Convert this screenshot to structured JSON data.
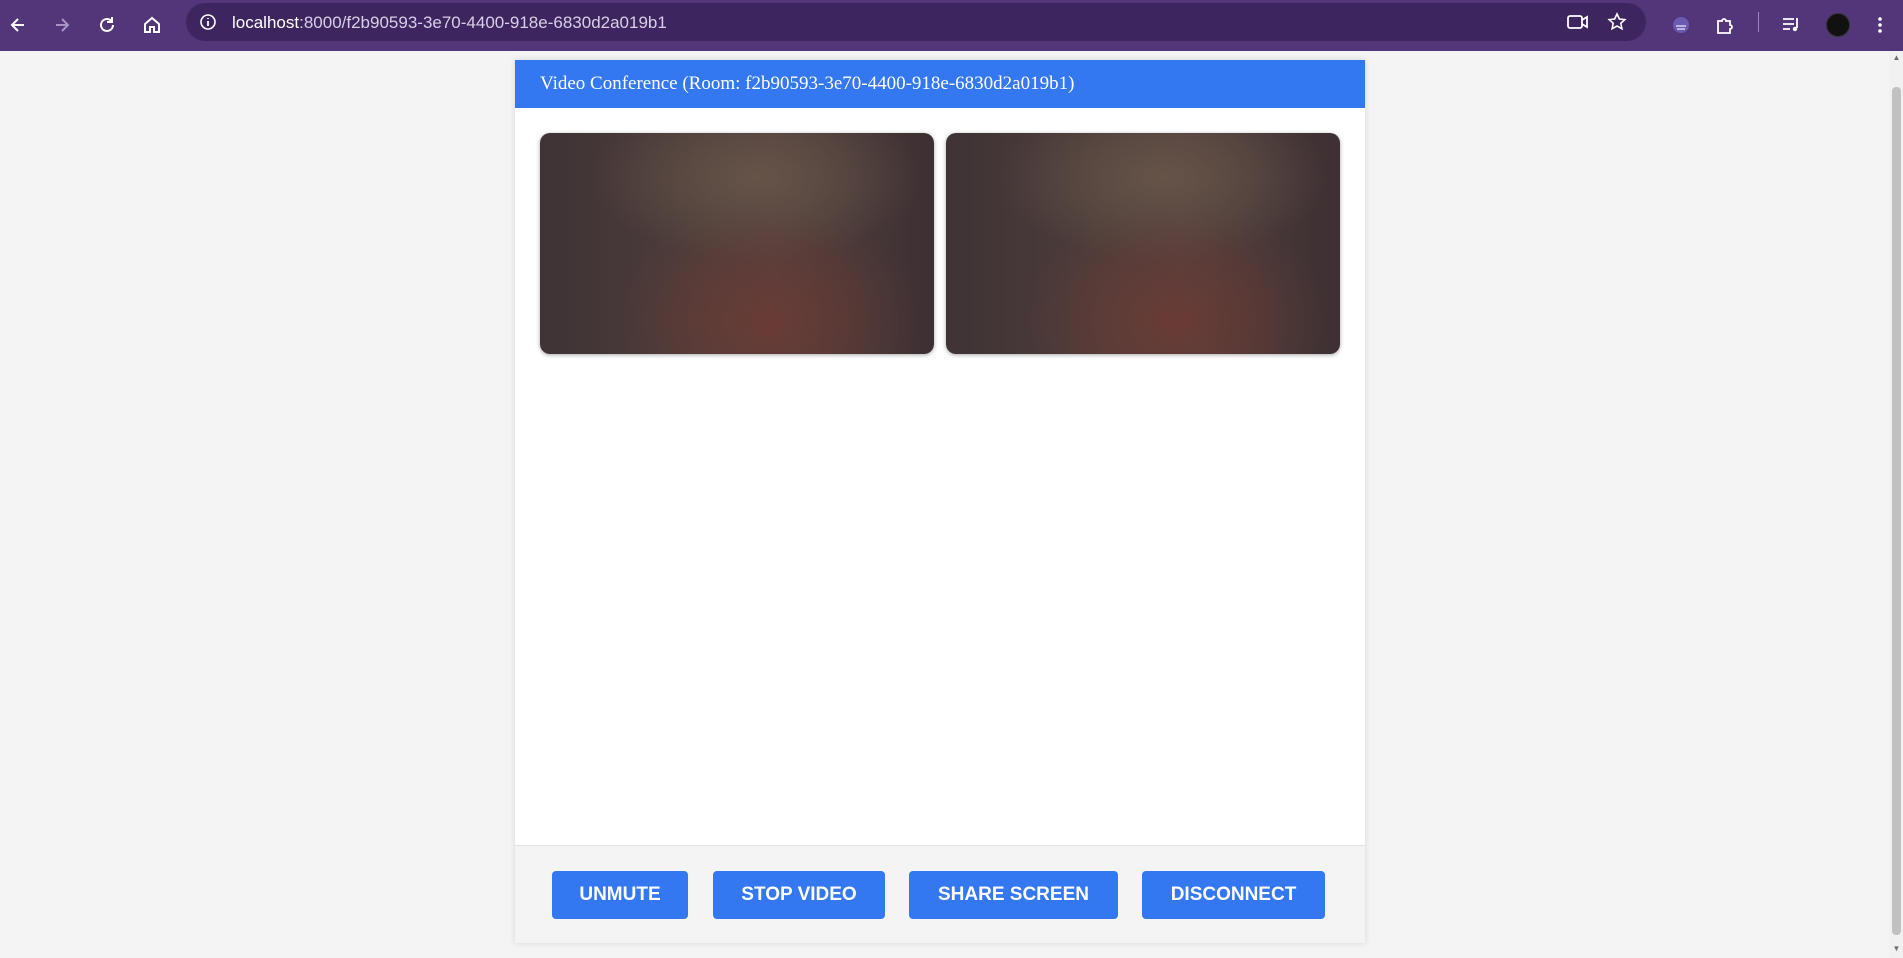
{
  "browser": {
    "url_host": "localhost",
    "url_path": ":8000/f2b90593-3e70-4400-918e-6830d2a019b1",
    "icons": [
      "back-icon",
      "forward-icon",
      "reload-icon",
      "home-icon",
      "site-info-icon",
      "camera-icon",
      "star-icon",
      "extension-profile-icon",
      "extensions-icon",
      "media-queue-icon",
      "avatar",
      "menu-icon"
    ]
  },
  "conference": {
    "title": "Video Conference (Room: f2b90593-3e70-4400-918e-6830d2a019b1)",
    "videos": [
      "local-video",
      "remote-video"
    ]
  },
  "controls": {
    "unmute": "UNMUTE",
    "stop_video": "STOP VIDEO",
    "share_screen": "SHARE SCREEN",
    "disconnect": "DISCONNECT"
  },
  "colors": {
    "chrome": "#533579",
    "accent": "#3378f0",
    "page_bg": "#f4f4f4"
  }
}
